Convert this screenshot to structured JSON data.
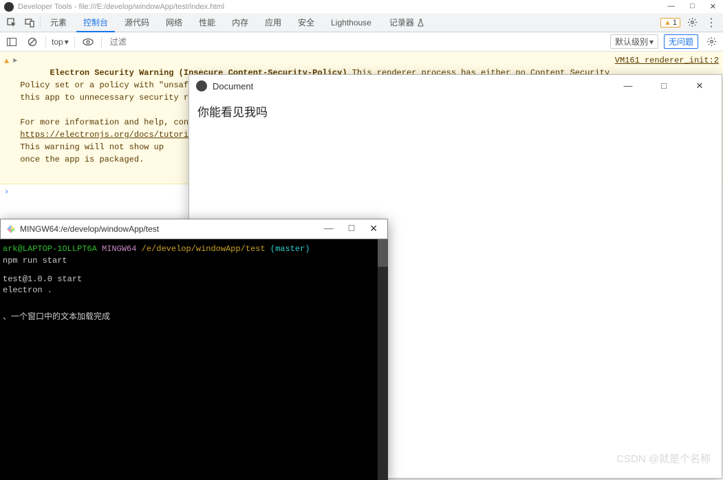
{
  "devtools": {
    "title": "Developer Tools - file:///E:/develop/windowApp/test/index.html",
    "window_controls": {
      "minimize": "—",
      "maximize": "□",
      "close": "✕"
    },
    "tabs": [
      "元素",
      "控制台",
      "源代码",
      "网络",
      "性能",
      "内存",
      "应用",
      "安全",
      "Lighthouse",
      "记录器"
    ],
    "tab_experimental_icon": "flask-icon",
    "active_tab_index": 1,
    "warning_count": "1",
    "subbar": {
      "context": "top",
      "filter_placeholder": "过滤",
      "level_label": "默认级别",
      "issues_label": "无问题"
    },
    "console": {
      "warning": {
        "title": "Electron Security Warning (Insecure Content-Security-Policy)",
        "body": "This renderer process has either no Content Security\nPolicy set or a policy with \"unsafe-eval\" enabled. This exposes users of\nthis app to unnecessary security risks.\n\nFor more information and help, consult\nhttps://electronjs.org/docs/tutorial/s\nThis warning will not show up\nonce the app is packaged.",
        "link": "https://electronjs.org/docs/tutorial/s",
        "source": "VM161 renderer_init:2"
      }
    }
  },
  "document_window": {
    "title": "Document",
    "controls": {
      "minimize": "—",
      "maximize": "□",
      "close": "✕"
    },
    "content": "你能看见我吗"
  },
  "terminal": {
    "title": "MINGW64:/e/develop/windowApp/test",
    "controls": {
      "minimize": "—",
      "maximize": "□",
      "close": "✕"
    },
    "prompt": {
      "user": "ark@LAPTOP-1OLLPT6A",
      "shell": "MINGW64",
      "path": "/e/develop/windowApp/test",
      "branch": "(master)"
    },
    "lines": {
      "cmd": " npm run start",
      "script1": " test@1.0.0 start",
      "script2": " electron .",
      "output": "、一个窗口中的文本加载完成"
    }
  },
  "watermark": "CSDN @就是个名称"
}
